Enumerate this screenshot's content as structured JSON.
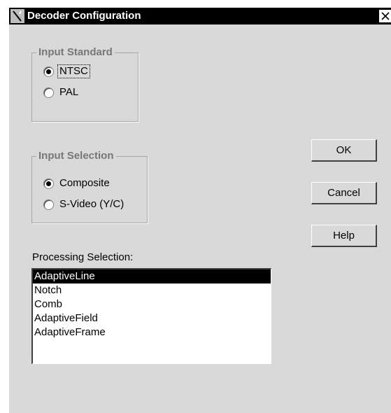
{
  "window": {
    "title": "Decoder Configuration",
    "close_glyph": "✕"
  },
  "input_standard": {
    "legend": "Input Standard",
    "options": [
      {
        "label": "NTSC",
        "checked": true
      },
      {
        "label": "PAL",
        "checked": false
      }
    ]
  },
  "input_selection": {
    "legend": "Input Selection",
    "options": [
      {
        "label": "Composite",
        "checked": true
      },
      {
        "label": "S-Video (Y/C)",
        "checked": false
      }
    ]
  },
  "buttons": {
    "ok": "OK",
    "cancel": "Cancel",
    "help": "Help"
  },
  "processing": {
    "label": "Processing Selection:",
    "items": [
      "AdaptiveLine",
      "Notch",
      "Comb",
      "AdaptiveField",
      "AdaptiveFrame"
    ],
    "selected": "AdaptiveLine"
  },
  "colors": {
    "dialog_bg": "#d9d9d9",
    "titlebar_bg": "#000000",
    "selection_bg": "#000000",
    "legend_text": "#777777"
  }
}
